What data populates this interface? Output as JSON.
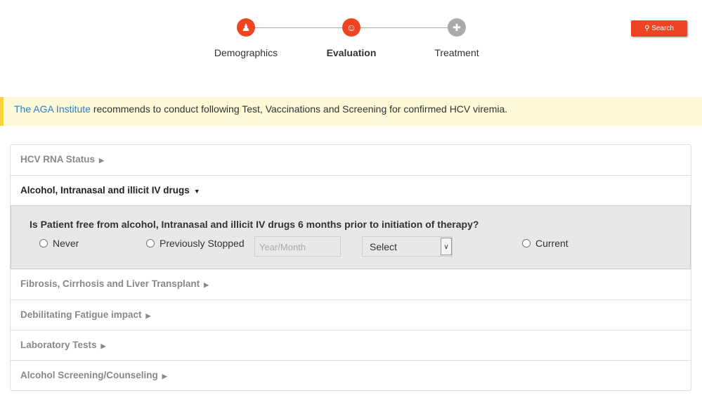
{
  "steps": [
    {
      "label": "Demographics",
      "icon": "person-icon",
      "state": "done"
    },
    {
      "label": "Evaluation",
      "icon": "doctor-icon",
      "state": "active"
    },
    {
      "label": "Treatment",
      "icon": "syringe-icon",
      "state": "pending"
    }
  ],
  "search_label": "Search",
  "banner": {
    "link": "The AGA Institute",
    "text": " recommends to conduct following Test, Vaccinations and Screening for confirmed HCV viremia."
  },
  "sections": [
    "HCV RNA Status",
    "Alcohol, Intranasal and illicit IV drugs",
    "Fibrosis, Cirrhosis and Liver Transplant",
    "Debilitating Fatigue impact",
    "Laboratory Tests",
    "Alcohol Screening/Counseling"
  ],
  "panel": {
    "question": "Is Patient free from alcohol, Intranasal and illicit IV drugs 6 months prior to initiation of therapy?",
    "options": [
      "Never",
      "Previously Stopped",
      "Current"
    ],
    "date_placeholder": "Year/Month",
    "select_value": "Select"
  },
  "colors": {
    "accent": "#ef4422",
    "pending": "#aaaaaa"
  }
}
